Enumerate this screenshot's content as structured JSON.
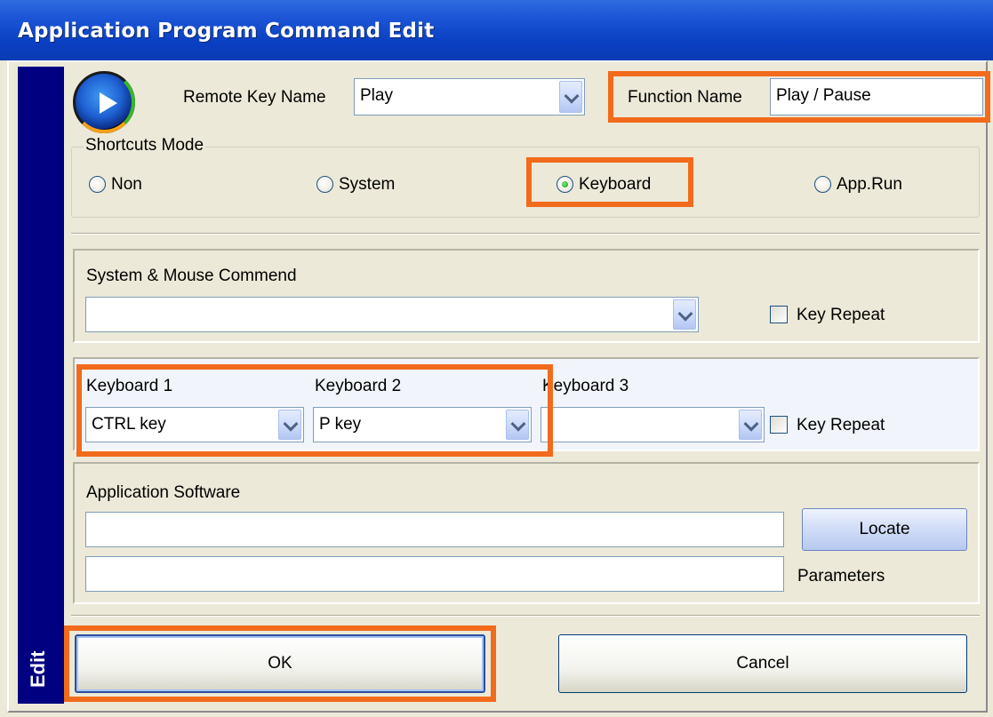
{
  "window": {
    "title": "Application Program Command Edit",
    "side_label": "Edit"
  },
  "header": {
    "remote_key_label": "Remote Key Name",
    "remote_key_value": "Play",
    "function_name_label": "Function Name",
    "function_name_value": "Play / Pause"
  },
  "shortcuts": {
    "group_label": "Shortcuts Mode",
    "options": [
      "Non",
      "System",
      "Keyboard",
      "App.Run"
    ],
    "selected": "Keyboard"
  },
  "system_mouse": {
    "label": "System & Mouse Commend",
    "value": "",
    "key_repeat_label": "Key Repeat",
    "key_repeat_checked": false
  },
  "keyboard": {
    "k1_label": "Keyboard 1",
    "k1_value": "CTRL key",
    "k2_label": "Keyboard 2",
    "k2_value": "P key",
    "k3_label": "Keyboard 3",
    "k3_value": "",
    "key_repeat_label": "Key Repeat",
    "key_repeat_checked": false
  },
  "application": {
    "label": "Application Software",
    "path_value": "",
    "parameters_value": "",
    "locate_label": "Locate",
    "parameters_label": "Parameters"
  },
  "buttons": {
    "ok_label": "OK",
    "cancel_label": "Cancel"
  },
  "colors": {
    "titlebar": "#0a3fc2",
    "highlight": "#f26a1b",
    "side_strip": "#000080",
    "dialog_bg": "#ece9d8"
  }
}
